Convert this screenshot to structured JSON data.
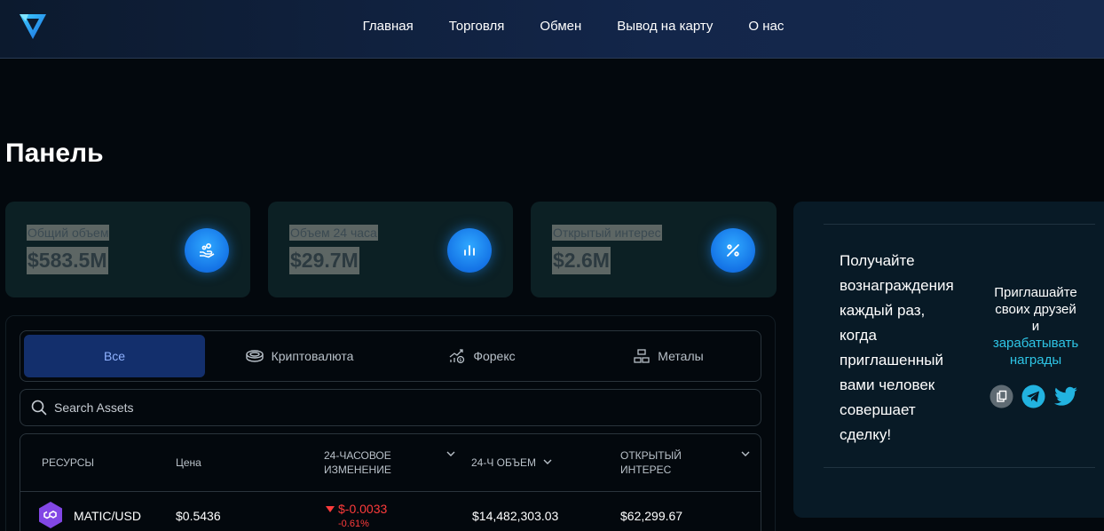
{
  "nav": {
    "links": [
      "Главная",
      "Торговля",
      "Обмен",
      "Вывод на карту",
      "О нас"
    ]
  },
  "page_title": "Панель",
  "stats": [
    {
      "label": "Общий объем",
      "value": "$583.5M",
      "icon": "hand-coins-icon"
    },
    {
      "label": "Объем 24 часа",
      "value": "$29.7M",
      "icon": "bar-chart-icon"
    },
    {
      "label": "Открытый интерес",
      "value": "$2.6M",
      "icon": "percent-icon"
    }
  ],
  "tabs": [
    {
      "label": "Все",
      "icon": ""
    },
    {
      "label": "Криптовалюта",
      "icon": "coin-icon"
    },
    {
      "label": "Форекс",
      "icon": "forex-icon"
    },
    {
      "label": "Металы",
      "icon": "metals-icon"
    }
  ],
  "search": {
    "placeholder": "Search Assets"
  },
  "table": {
    "headers": {
      "resources": "РЕСУРСЫ",
      "price": "Цена",
      "change_line1": "24-ЧАСОВОЕ",
      "change_line2": "ИЗМЕНЕНИЕ",
      "volume": "24-Ч ОБЪЕМ",
      "interest_line1": "ОТКРЫТЫЙ",
      "interest_line2": "ИНТЕРЕС"
    },
    "rows": [
      {
        "asset": "MATIC/USD",
        "price": "$0.5436",
        "change": "$-0.0033",
        "change_pct": "-0.61%",
        "volume": "$14,482,303.03",
        "interest": "$62,299.67"
      }
    ]
  },
  "rewards": {
    "text_lines": [
      "Получайте",
      "вознаграждения",
      "каждый раз,",
      "когда",
      "приглашенный",
      "вами человек",
      "совершает",
      "сделку!"
    ],
    "invite_line1": "Приглашайте",
    "invite_line2": "своих друзей",
    "invite_line3": "и",
    "invite_link1": "зарабатывать",
    "invite_link2": "награды"
  },
  "colors": {
    "accent_blue": "#1473e6",
    "negative": "#ff3b3b",
    "link": "#2ec5e6",
    "matic": "#8247e5"
  }
}
